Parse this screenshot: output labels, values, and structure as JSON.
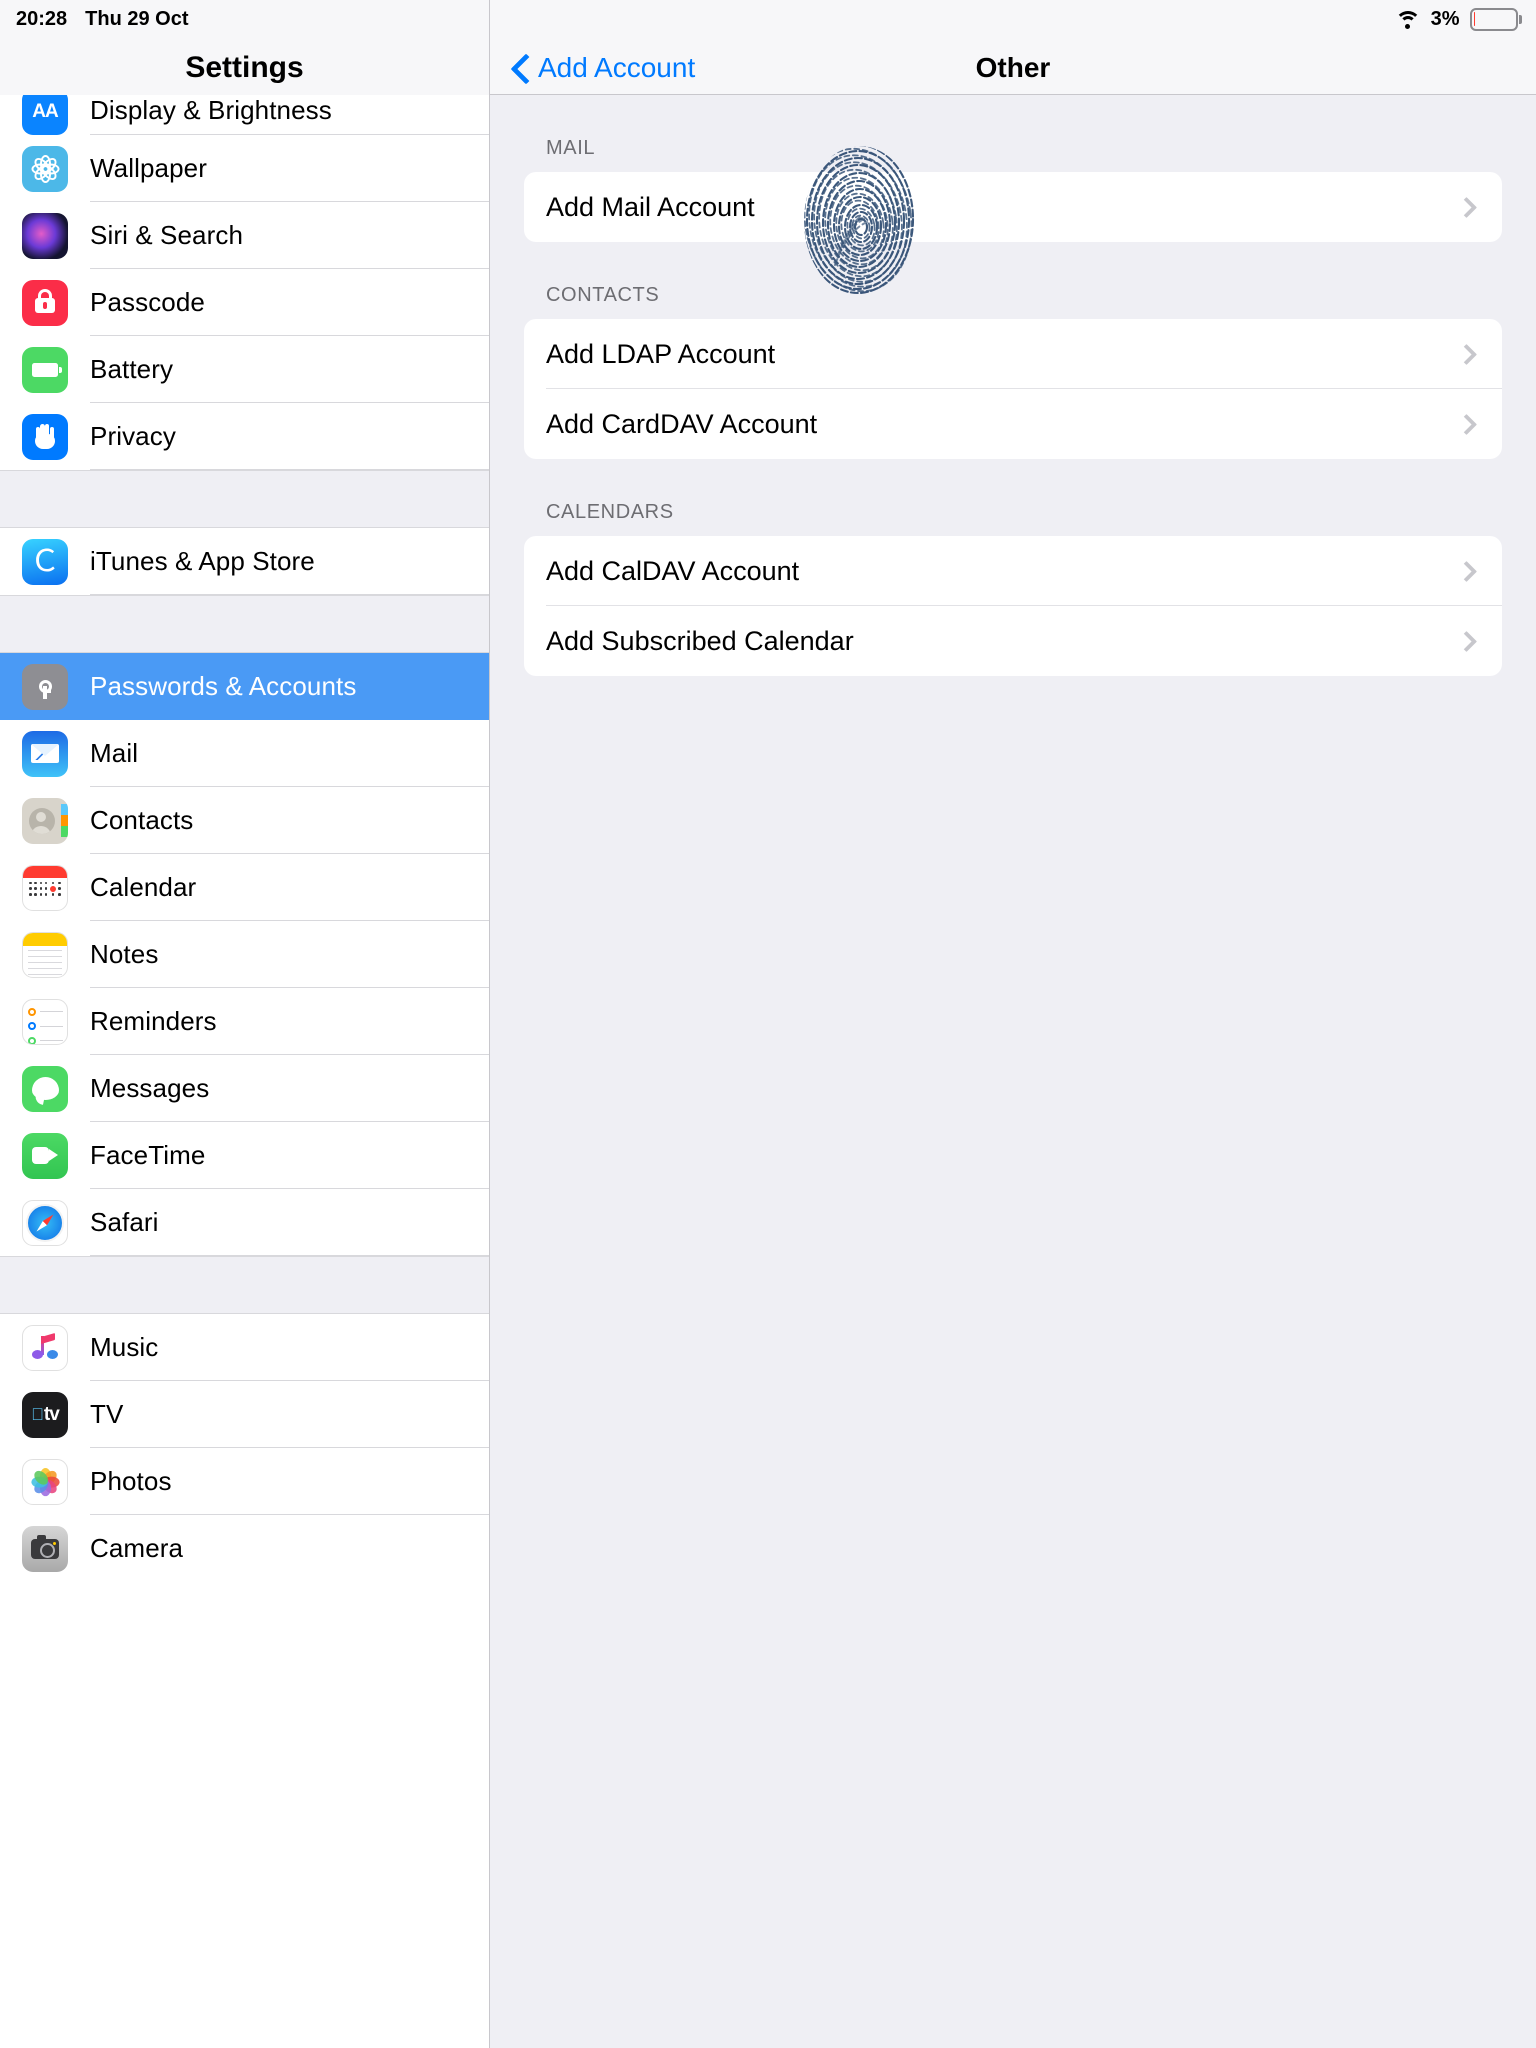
{
  "status_bar": {
    "time": "20:28",
    "date": "Thu 29 Oct",
    "wifi_icon": "wifi-icon",
    "battery_percent": "3%",
    "battery_level": 3,
    "battery_color": "#ff3b30"
  },
  "sidebar": {
    "title": "Settings",
    "selected_item": "Passwords & Accounts",
    "selected_color": "#4a9af5",
    "items": [
      {
        "label": "Display & Brightness",
        "icon": "display-brightness-icon",
        "group": 0,
        "clipped": true
      },
      {
        "label": "Wallpaper",
        "icon": "wallpaper-icon",
        "group": 0
      },
      {
        "label": "Siri & Search",
        "icon": "siri-search-icon",
        "group": 0
      },
      {
        "label": "Passcode",
        "icon": "passcode-lock-icon",
        "group": 0
      },
      {
        "label": "Battery",
        "icon": "battery-icon",
        "group": 0
      },
      {
        "label": "Privacy",
        "icon": "privacy-hand-icon",
        "group": 0
      },
      {
        "label": "iTunes & App Store",
        "icon": "app-store-icon",
        "group": 1
      },
      {
        "label": "Passwords & Accounts",
        "icon": "key-icon",
        "group": 2,
        "selected": true
      },
      {
        "label": "Mail",
        "icon": "mail-envelope-icon",
        "group": 2
      },
      {
        "label": "Contacts",
        "icon": "contacts-icon",
        "group": 2
      },
      {
        "label": "Calendar",
        "icon": "calendar-icon",
        "group": 2
      },
      {
        "label": "Notes",
        "icon": "notes-icon",
        "group": 2
      },
      {
        "label": "Reminders",
        "icon": "reminders-icon",
        "group": 2
      },
      {
        "label": "Messages",
        "icon": "messages-icon",
        "group": 2
      },
      {
        "label": "FaceTime",
        "icon": "facetime-icon",
        "group": 2
      },
      {
        "label": "Safari",
        "icon": "safari-compass-icon",
        "group": 2
      },
      {
        "label": "Music",
        "icon": "music-note-icon",
        "group": 3
      },
      {
        "label": "TV",
        "icon": "apple-tv-icon",
        "group": 3
      },
      {
        "label": "Photos",
        "icon": "photos-pinwheel-icon",
        "group": 3
      },
      {
        "label": "Camera",
        "icon": "camera-icon",
        "group": 3
      }
    ]
  },
  "detail": {
    "back_label": "Add Account",
    "back_icon": "chevron-left-icon",
    "title": "Other",
    "accent_color": "#007aff",
    "sections": [
      {
        "header": "MAIL",
        "rows": [
          {
            "label": "Add Mail Account",
            "chevron": "chevron-right-icon"
          }
        ]
      },
      {
        "header": "CONTACTS",
        "rows": [
          {
            "label": "Add LDAP Account",
            "chevron": "chevron-right-icon"
          },
          {
            "label": "Add CardDAV Account",
            "chevron": "chevron-right-icon"
          }
        ]
      },
      {
        "header": "CALENDARS",
        "rows": [
          {
            "label": "Add CalDAV Account",
            "chevron": "chevron-right-icon"
          },
          {
            "label": "Add Subscribed Calendar",
            "chevron": "chevron-right-icon"
          }
        ]
      }
    ]
  },
  "overlay": {
    "fingerprint_icon": "fingerprint-smudge",
    "fingerprint_color": "#2c4a70"
  }
}
